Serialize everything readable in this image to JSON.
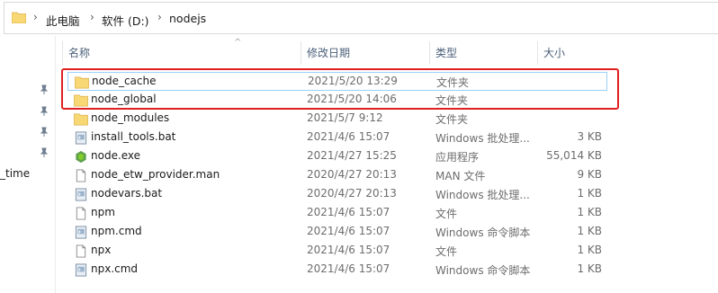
{
  "breadcrumb": {
    "items": [
      "此电脑",
      "软件 (D:)",
      "nodejs"
    ],
    "separator": "›"
  },
  "nav": {
    "partial_label": "_time",
    "pin_icon": "pin-icon"
  },
  "columns": {
    "name": "名称",
    "date": "修改日期",
    "type": "类型",
    "size": "大小"
  },
  "files": [
    {
      "name": "node_cache",
      "date": "2021/5/20 13:29",
      "type": "文件夹",
      "size": "",
      "icon": "folder-icon"
    },
    {
      "name": "node_global",
      "date": "2021/5/20 14:06",
      "type": "文件夹",
      "size": "",
      "icon": "folder-icon"
    },
    {
      "name": "node_modules",
      "date": "2021/5/7 9:12",
      "type": "文件夹",
      "size": "",
      "icon": "folder-icon"
    },
    {
      "name": "install_tools.bat",
      "date": "2021/4/6 15:07",
      "type": "Windows 批处理...",
      "size": "3 KB",
      "icon": "batch-file-icon"
    },
    {
      "name": "node.exe",
      "date": "2021/4/27 15:25",
      "type": "应用程序",
      "size": "55,014 KB",
      "icon": "nodejs-exe-icon"
    },
    {
      "name": "node_etw_provider.man",
      "date": "2020/4/27 20:13",
      "type": "MAN 文件",
      "size": "9 KB",
      "icon": "file-icon"
    },
    {
      "name": "nodevars.bat",
      "date": "2020/4/27 20:13",
      "type": "Windows 批处理...",
      "size": "1 KB",
      "icon": "batch-file-icon"
    },
    {
      "name": "npm",
      "date": "2021/4/6 15:07",
      "type": "文件",
      "size": "1 KB",
      "icon": "file-icon"
    },
    {
      "name": "npm.cmd",
      "date": "2021/4/6 15:07",
      "type": "Windows 命令脚本",
      "size": "1 KB",
      "icon": "cmd-file-icon"
    },
    {
      "name": "npx",
      "date": "2021/4/6 15:07",
      "type": "文件",
      "size": "1 KB",
      "icon": "file-icon"
    },
    {
      "name": "npx.cmd",
      "date": "2021/4/6 15:07",
      "type": "Windows 命令脚本",
      "size": "1 KB",
      "icon": "cmd-file-icon"
    }
  ],
  "colors": {
    "highlight_box": "#e02020",
    "selection_border": "#99d1ff",
    "folder_yellow": "#f8d775",
    "header_text": "#4c607a"
  }
}
